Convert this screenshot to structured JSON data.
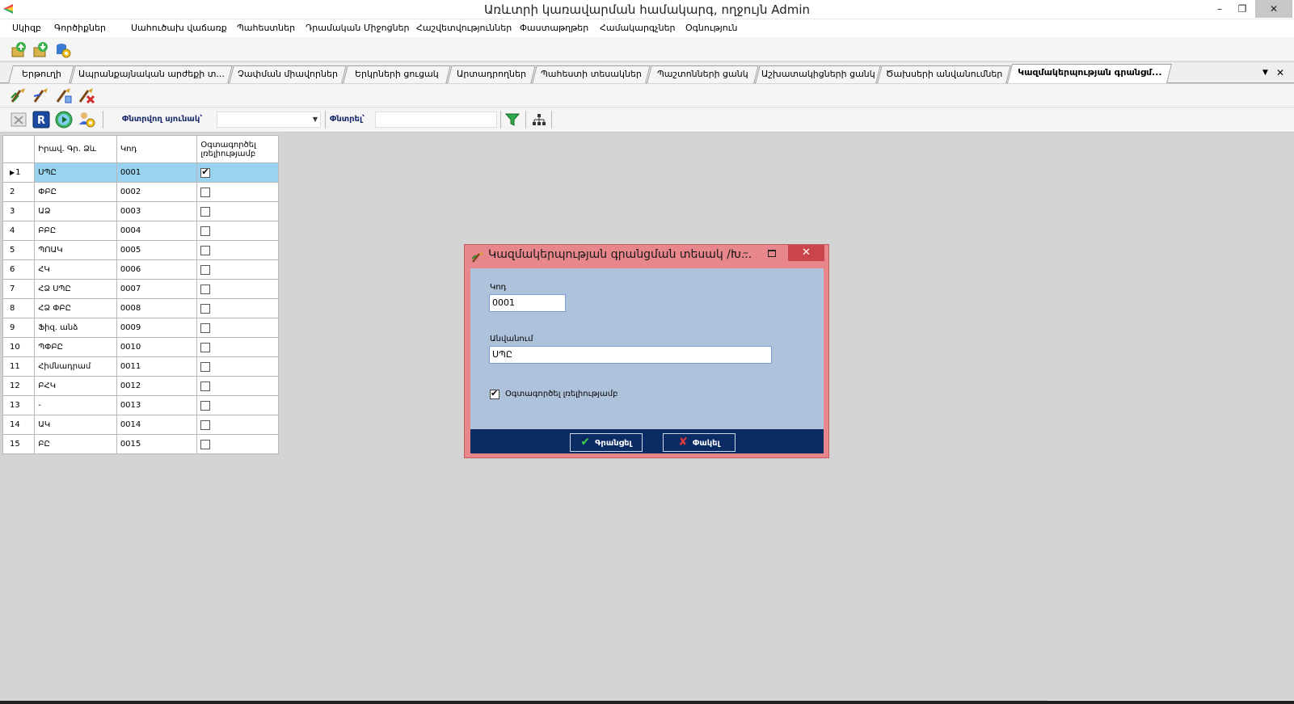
{
  "window": {
    "title": "Առևտրի կառավարման համակարգ, ողջույն Admin",
    "min_glyph": "–",
    "restore_glyph": "❐",
    "close_glyph": "✕"
  },
  "menu": [
    "Սկիզբ",
    "Գործիքներ",
    "Սահուծախ վաճառք",
    "Պահեստներ",
    "Դրամական Միջոցներ",
    "Հաշվետվություններ",
    "Փաստաթղթեր",
    "Համակարգչներ",
    "Օգնություն"
  ],
  "tabs": [
    "Երթուղի",
    "Ապրանքայնական արժեքի տ...",
    "Չափման միավորներ",
    "Երկրների ցուցակ",
    "Արտադրողներ",
    "Պահեստի տեսակներ",
    "Պաշտոնների ցանկ",
    "Աշխատակիցների ցանկ",
    "Ծախսերի անվանումներ",
    "Կազմակերպության գրանցմ..."
  ],
  "tab_controls": {
    "dropdown": "▼",
    "close": "✕"
  },
  "filter_bar": {
    "search_column_label": "Փնտրվող սյունակ՝",
    "search_label": "Փնտրել՝"
  },
  "grid": {
    "headers": [
      "Իրավ. Գր. Ձև",
      "Կոդ",
      "Օգտագործել լռելիությամբ"
    ],
    "rows": [
      {
        "n": "1",
        "form": "ՍՊԸ",
        "code": "0001",
        "default": true
      },
      {
        "n": "2",
        "form": "ՓԲԸ",
        "code": "0002",
        "default": false
      },
      {
        "n": "3",
        "form": "ԱՁ",
        "code": "0003",
        "default": false
      },
      {
        "n": "4",
        "form": "ԲԲԸ",
        "code": "0004",
        "default": false
      },
      {
        "n": "5",
        "form": "ՊՈԱԿ",
        "code": "0005",
        "default": false
      },
      {
        "n": "6",
        "form": "ՀԿ",
        "code": "0006",
        "default": false
      },
      {
        "n": "7",
        "form": "ՀՁ ՍՊԸ",
        "code": "0007",
        "default": false
      },
      {
        "n": "8",
        "form": "ՀՁ ՓԲԸ",
        "code": "0008",
        "default": false
      },
      {
        "n": "9",
        "form": "Ֆիզ. անձ",
        "code": "0009",
        "default": false
      },
      {
        "n": "10",
        "form": "ՊՓԲԸ",
        "code": "0010",
        "default": false
      },
      {
        "n": "11",
        "form": "Հիմնադրամ",
        "code": "0011",
        "default": false
      },
      {
        "n": "12",
        "form": "ԲՀԿ",
        "code": "0012",
        "default": false
      },
      {
        "n": "13",
        "form": "-",
        "code": "0013",
        "default": false
      },
      {
        "n": "14",
        "form": "ԱԿ",
        "code": "0014",
        "default": false
      },
      {
        "n": "15",
        "form": "ԲԸ",
        "code": "0015",
        "default": false
      }
    ],
    "selected_row": 1
  },
  "dialog": {
    "title": "Կազմակերպության գրանցման տեսակ /Խ...",
    "min_glyph": "–",
    "close_glyph": "✕",
    "code_label": "Կոդ",
    "code_value": "0001",
    "name_label": "Անվանում",
    "name_value": "ՍՊԸ",
    "default_label": "Օգտագործել լռելիությամբ",
    "save_label": "Գրանցել",
    "close_label": "Փակել",
    "save_icon": "✔",
    "close_icon": "✘"
  },
  "colors": {
    "selected_row": "#99d3ef",
    "dialog_frame": "#e7868b",
    "dialog_body": "#afc2dc",
    "dialog_footer": "#0b2b65",
    "label_blue": "#1a2a6a"
  }
}
